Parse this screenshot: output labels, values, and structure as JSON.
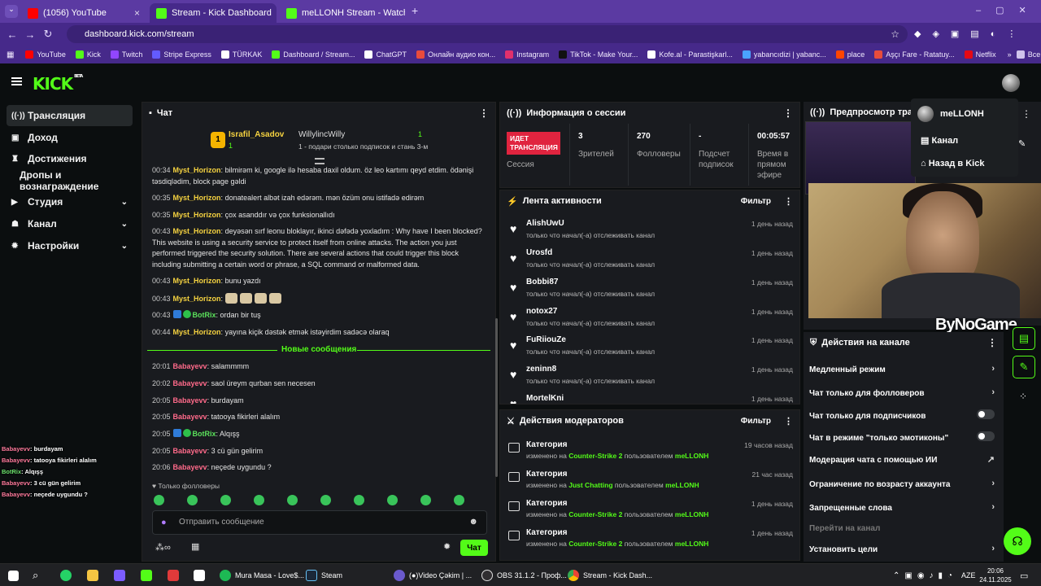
{
  "browser": {
    "tabs": [
      {
        "title": "(1056) YouTube",
        "color": "#ff0000"
      },
      {
        "title": "Stream - Kick Dashboard",
        "color": "#53fc18"
      },
      {
        "title": "meLLONH Stream - Watch Live",
        "color": "#53fc18"
      }
    ],
    "url": "dashboard.kick.com/stream",
    "bookmarks": [
      "YouTube",
      "Kick",
      "Twitch",
      "Stripe Express",
      "TÜRKAK",
      "Dashboard / Stream...",
      "ChatGPT",
      "Онлайн аудио кон...",
      "Instagram",
      "TikTok - Make Your...",
      "Kofe.al - Parastişkarl...",
      "yabancıdizi | yabanc...",
      "place",
      "Aşçı Fare - Ratatuy...",
      "Netflix"
    ],
    "all_bookmarks": "Все закладки"
  },
  "kick": {
    "logo": "KICK",
    "beta": "BETA"
  },
  "sidebar": {
    "items": [
      {
        "label": "Трансляция",
        "icon": "broadcast-icon"
      },
      {
        "label": "Доход",
        "icon": "wallet-icon"
      },
      {
        "label": "Достижения",
        "icon": "trophy-icon"
      },
      {
        "label": "Дропы и вознаграждение"
      },
      {
        "label": "Студия",
        "icon": "video-icon"
      },
      {
        "label": "Канал",
        "icon": "users-icon"
      },
      {
        "label": "Настройки",
        "icon": "gear-icon"
      }
    ]
  },
  "chat": {
    "title": "Чат",
    "top": {
      "user1": "Israfil_Asadov",
      "user1_count": "1",
      "user2": "WillylincWilly",
      "user2_count": "1",
      "gift_text": "1 - подари столько подписок и стань 3-м",
      "rank": "1"
    },
    "messages": [
      {
        "time": "00:34",
        "user": "Myst_Horizon",
        "text": "bilmirəm ki, google ilə hesaba daxil oldum. öz leo kartımı qeyd etdim. ödənişi təsdiqlədim, block page gəldi"
      },
      {
        "time": "00:35",
        "user": "Myst_Horizon",
        "text": "donatealert albət izah edərəm. mən özüm onu istifadə edirəm"
      },
      {
        "time": "00:35",
        "user": "Myst_Horizon",
        "text": "çox asanddır və çox funksionallıdı"
      },
      {
        "time": "00:43",
        "user": "Myst_Horizon",
        "text": "deyəsən sırf leonu bloklayır, ikinci dəfədə yoxladım : Why have I been blocked? This website is using a security service to protect itself from online attacks. The action you just performed triggered the security solution. There are several actions that could trigger this block including submitting a certain word or phrase, a SQL command or malformed data."
      },
      {
        "time": "00:43",
        "user": "Myst_Horizon",
        "text": "bunu yazdı"
      },
      {
        "time": "00:43",
        "user": "Myst_Horizon",
        "text": ""
      },
      {
        "time": "00:43",
        "user": "BotRix",
        "text": "ordan bir tuş"
      },
      {
        "time": "00:44",
        "user": "Myst_Horizon",
        "text": "yayına kiçik dəstək etmək istəyirdim sadəcə olaraq"
      }
    ],
    "new_messages": "Новые сообщения",
    "new_list": [
      {
        "time": "20:01",
        "user": "Babayevv",
        "text": "salammmm"
      },
      {
        "time": "20:02",
        "user": "Babayevv",
        "text": "saol üreym qurban sen necesen"
      },
      {
        "time": "20:05",
        "user": "Babayevv",
        "text": "burdayam"
      },
      {
        "time": "20:05",
        "user": "Babayevv",
        "text": "tatooya fikirleri alalım"
      },
      {
        "time": "20:05",
        "user": "BotRix",
        "text": "Alqışş"
      },
      {
        "time": "20:05",
        "user": "Babayevv",
        "text": "3 cü gün gelirim"
      },
      {
        "time": "20:06",
        "user": "Babayevv",
        "text": "neçede uygundu ?"
      }
    ],
    "followers_only": "Только фолловеры",
    "placeholder": "Отправить сообщение",
    "send": "Чат"
  },
  "session": {
    "title": "Информация о сессии",
    "live": "ИДЕТ ТРАНСЛЯЦИЯ",
    "live_label": "Сессия",
    "viewers": "3",
    "viewers_label": "Зрителей",
    "followers": "270",
    "followers_label": "Фолловеры",
    "subs": "-",
    "subs_label": "Подсчет подписок",
    "time": "00:05:57",
    "time_label": "Время в прямом эфире"
  },
  "activity": {
    "title": "Лента активности",
    "filter": "Фильтр",
    "items": [
      {
        "name": "AlishUwU",
        "sub": "только что начал(-а) отслеживать канал",
        "date": "1 день назад"
      },
      {
        "name": "Urosfd",
        "sub": "только что начал(-а) отслеживать канал",
        "date": "1 день назад"
      },
      {
        "name": "Bobbi87",
        "sub": "только что начал(-а) отслеживать канал",
        "date": "1 день назад"
      },
      {
        "name": "notox27",
        "sub": "только что начал(-а) отслеживать канал",
        "date": "1 день назад"
      },
      {
        "name": "FuRiiouZe",
        "sub": "только что начал(-а) отслеживать канал",
        "date": "1 день назад"
      },
      {
        "name": "zeninn8",
        "sub": "только что начал(-а) отслеживать канал",
        "date": "1 день назад"
      },
      {
        "name": "MortelKni",
        "sub": "",
        "date": "1 день назад"
      }
    ]
  },
  "mods": {
    "title": "Действия модераторов",
    "filter": "Фильтр",
    "items": [
      {
        "name": "Категория",
        "changed": "изменено на",
        "category": "Counter-Strike 2",
        "by": "пользователем",
        "user": "meLLONH",
        "date": "19 часов назад"
      },
      {
        "name": "Категория",
        "changed": "изменено на",
        "category": "Just Chatting",
        "by": "пользователем",
        "user": "meLLONH",
        "date": "21 час назад"
      },
      {
        "name": "Категория",
        "changed": "изменено на",
        "category": "Counter-Strike 2",
        "by": "пользователем",
        "user": "meLLONH",
        "date": "1 день назад"
      },
      {
        "name": "Категория",
        "changed": "изменено на",
        "category": "Counter-Strike 2",
        "by": "пользователем",
        "user": "meLLONH",
        "date": "1 день назад"
      }
    ]
  },
  "preview": {
    "title": "Предпросмотр трансля",
    "watermark": "ByNoGame"
  },
  "menu": {
    "user": "meLLONH",
    "channel": "Канал",
    "back": "Назад в Kick"
  },
  "actions": {
    "title": "Действия на канале",
    "items": [
      {
        "label": "Медленный режим",
        "kind": "chevron"
      },
      {
        "label": "Чат только для фолловеров",
        "kind": "chevron"
      },
      {
        "label": "Чат только для подписчиков",
        "kind": "toggle"
      },
      {
        "label": "Чат в режиме \"только эмотиконы\"",
        "kind": "toggle"
      },
      {
        "label": "Модерация чата с помощью ИИ",
        "kind": "external"
      },
      {
        "label": "Ограничение по возрасту аккаунта",
        "kind": "chevron"
      },
      {
        "label": "Запрещенные слова",
        "kind": "chevron"
      },
      {
        "label": "Перейти на канал",
        "kind": "none"
      },
      {
        "label": "Установить цели",
        "kind": "chevron"
      }
    ]
  },
  "overlay": [
    {
      "user": "Babayevv",
      "text": "burdayam"
    },
    {
      "user": "Babayevv",
      "text": "tatooya fikirleri alalım"
    },
    {
      "user": "BotRix",
      "text": "Alqışş"
    },
    {
      "user": "Babayevv",
      "text": "3 cü gün gelirim"
    },
    {
      "user": "Babayevv",
      "text": "neçede uygundu ?"
    }
  ],
  "taskbar": {
    "apps": [
      "Mura Masa - Love$...",
      "Steam",
      "(●)Video Çəkim | ...",
      "OBS 31.1.2 - Проф...",
      "Stream - Kick Dash..."
    ],
    "lang": "AZE",
    "time": "20:06",
    "date": "24.11.2025"
  }
}
